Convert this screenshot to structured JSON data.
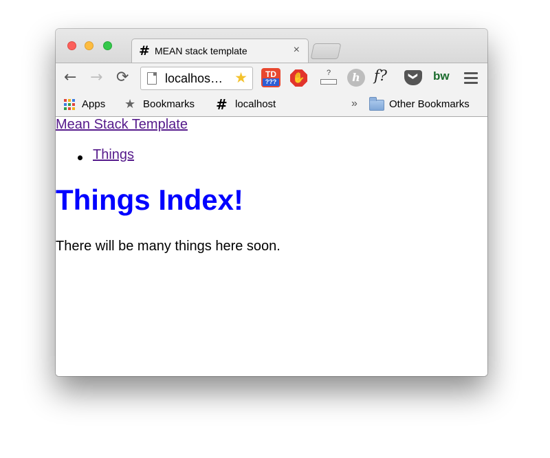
{
  "browser": {
    "tab": {
      "favicon": "#",
      "title": "MEAN stack template",
      "close": "×"
    },
    "toolbar": {
      "back_icon": "←",
      "forward_icon": "→",
      "reload_icon": "⟳",
      "url": "localhos…",
      "bookmark_star_icon": "★"
    },
    "extensions": {
      "td_top": "TD",
      "td_bottom": "???",
      "stop_icon": "✋",
      "unknown_label": "?",
      "hlink_label": "h",
      "fq_label": "f?",
      "pocket_icon": "❯",
      "bw_label": "bw"
    },
    "bookmarks_bar": {
      "items": [
        {
          "label": "Apps"
        },
        {
          "label": "Bookmarks",
          "icon": "★"
        },
        {
          "label": "localhost",
          "icon": "#"
        }
      ],
      "overflow": "»",
      "other": "Other Bookmarks"
    }
  },
  "page": {
    "brand": "Mean Stack Template",
    "nav": [
      {
        "label": "Things"
      }
    ],
    "heading": "Things Index!",
    "text": "There will be many things here soon."
  },
  "colors": {
    "link_visited": "#551a8b",
    "heading": "#0000ff",
    "traffic_red": "#fc605b",
    "traffic_yellow": "#fdbc40",
    "traffic_green": "#34c84a"
  }
}
